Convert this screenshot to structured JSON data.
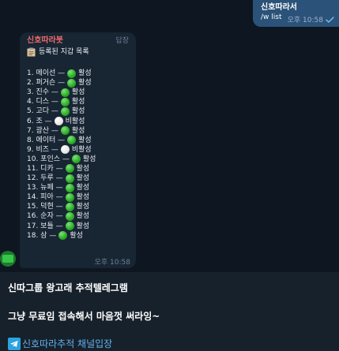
{
  "outgoing": {
    "sender": "신호따라서",
    "text": "/w list",
    "time": "오후 10:58"
  },
  "incoming": {
    "sender": "신호따라봇",
    "reply_label": "답장",
    "list_title": "등록된 지갑 목록",
    "time": "오후 10:58",
    "items": [
      {
        "label": "1. 메이선 —",
        "status": "활성",
        "active": true
      },
      {
        "label": "2. 퍼거슨 —",
        "status": "활성",
        "active": true
      },
      {
        "label": "3. 진수 —",
        "status": "활성",
        "active": true
      },
      {
        "label": "4. 디스 —",
        "status": "활성",
        "active": true
      },
      {
        "label": "5. 고다 —",
        "status": "활성",
        "active": true
      },
      {
        "label": "6. 조 —",
        "status": "비활성",
        "active": false
      },
      {
        "label": "7. 광산 —",
        "status": "활성",
        "active": true
      },
      {
        "label": "8. 에이터 —",
        "status": "활성",
        "active": true
      },
      {
        "label": "9. 비즈 —",
        "status": "비활성",
        "active": false
      },
      {
        "label": "10. 포인스 —",
        "status": "활성",
        "active": true
      },
      {
        "label": "11. 디카 —",
        "status": "활성",
        "active": true
      },
      {
        "label": "12. 두루 —",
        "status": "활성",
        "active": true
      },
      {
        "label": "13. 뉴페 —",
        "status": "활성",
        "active": true
      },
      {
        "label": "14. 피아 —",
        "status": "활성",
        "active": true
      },
      {
        "label": "15. 덕현 —",
        "status": "활성",
        "active": true
      },
      {
        "label": "16. 순자 —",
        "status": "활성",
        "active": true
      },
      {
        "label": "17. 보틀 —",
        "status": "활성",
        "active": true
      },
      {
        "label": "18. 삼 —",
        "status": "활성",
        "active": true
      }
    ]
  },
  "channel": {
    "line1": "신따그룹 왕고래 추적텔레그램",
    "line2": "그냥 무료임 접속해서 마음껏 써라잉~",
    "link_label": "신호따라추적 채널입장"
  },
  "colors": {
    "chat_bg": "#0e1621",
    "outgoing_bubble": "#2b5278",
    "incoming_bubble": "#182533",
    "sender_name": "#ee6b6b",
    "link": "#62b1f0",
    "active_dot": "#2fb12a",
    "inactive_dot": "#e6e6e6"
  },
  "icons": {
    "check": "check-icon",
    "clipboard": "clipboard-icon",
    "telegram": "telegram-icon"
  }
}
